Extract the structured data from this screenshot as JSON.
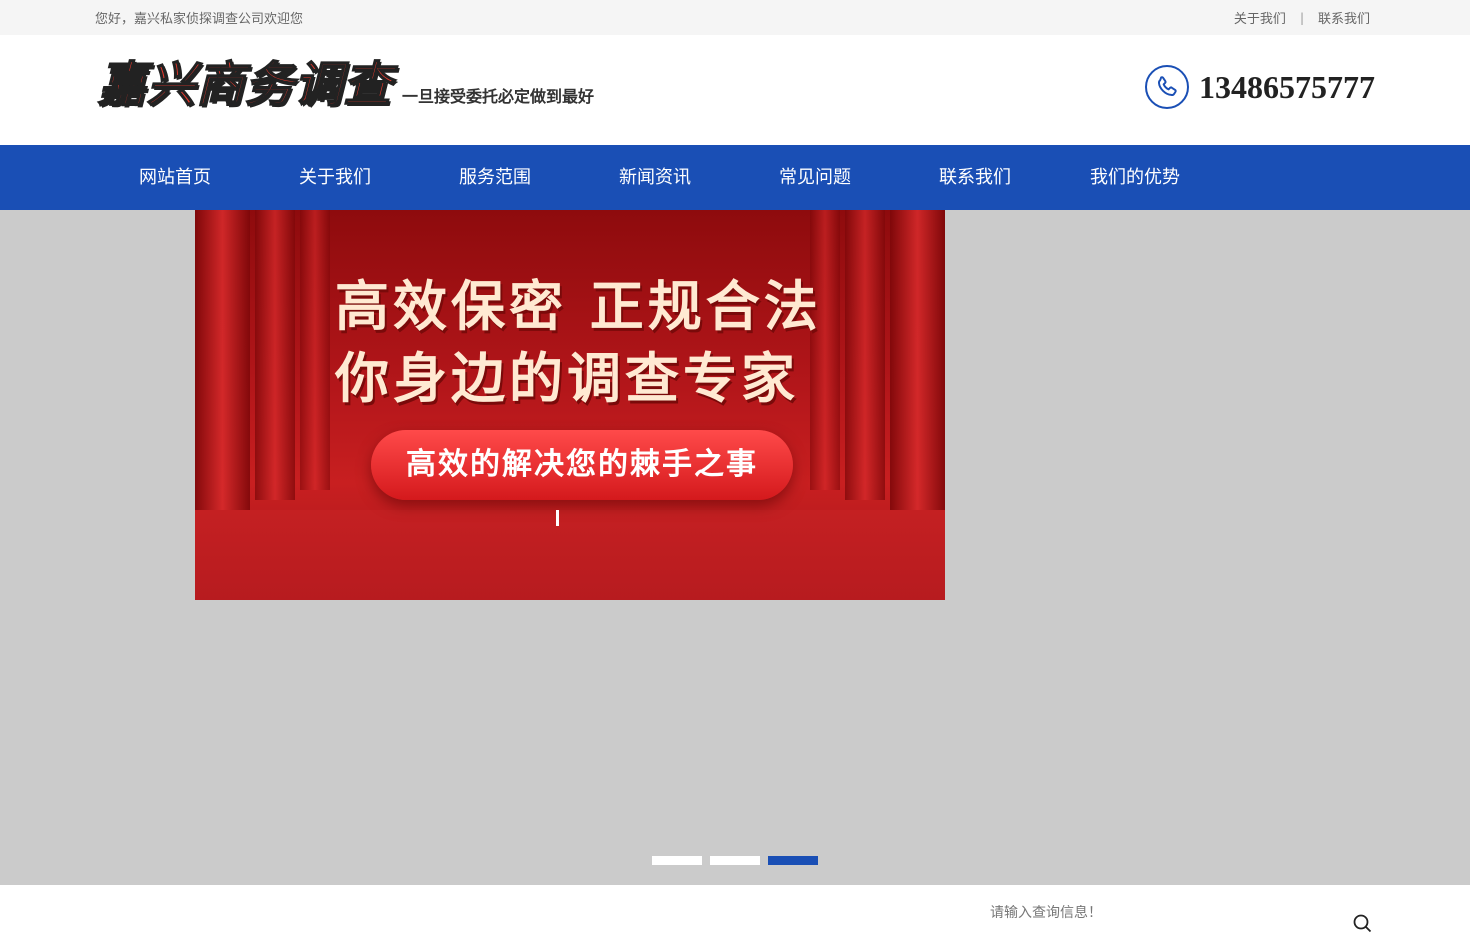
{
  "topbar": {
    "welcome": "您好，嘉兴私家侦探调查公司欢迎您",
    "links": [
      "关于我们",
      "联系我们"
    ],
    "separator": "|"
  },
  "header": {
    "logo_text": "嘉兴商务调查",
    "slogan": "一旦接受委托必定做到最好",
    "phone": "13486575777",
    "phone_icon": "phone-icon"
  },
  "nav": {
    "items": [
      "网站首页",
      "关于我们",
      "服务范围",
      "新闻资讯",
      "常见问题",
      "联系我们",
      "我们的优势"
    ]
  },
  "banner": {
    "line1": "高效保密  正规合法",
    "line2": "你身边的调查专家",
    "button_text": "高效的解决您的棘手之事",
    "slide_count": 3,
    "active_index": 2
  },
  "search": {
    "placeholder": "请输入查询信息！"
  },
  "colors": {
    "brand_blue": "#1a4fb5",
    "banner_bg": "#cbcbcb",
    "slide_red": "#b3161a"
  }
}
